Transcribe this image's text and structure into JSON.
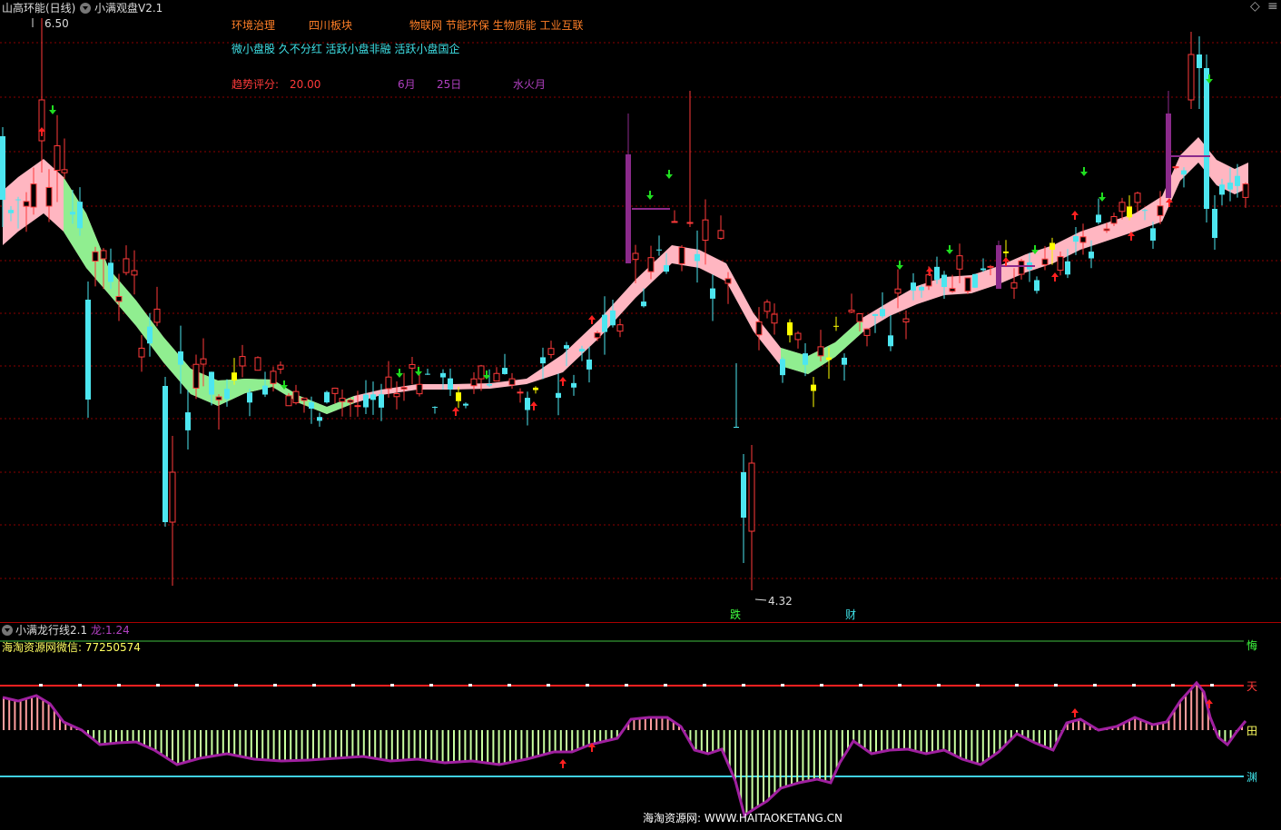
{
  "main": {
    "stock_title": "山高环能(日线)",
    "indicator_title": "小满观盘V2.1",
    "concepts_row1": [
      "环境治理",
      "四川板块",
      "物联网 节能环保 生物质能 工业互联"
    ],
    "concepts_row2": "微小盘股 久不分红 活跃小盘非融 活跃小盘国企",
    "trend_label": "趋势评分:",
    "trend_value": "20.00",
    "month": "6月",
    "day": "25日",
    "element": "水火月",
    "high_label": "6.50",
    "low_label": "4.32",
    "mark_die": "跌",
    "mark_cai": "财",
    "diamond_icon": "◇",
    "menu_icon": "≡"
  },
  "sub": {
    "title": "小满龙行线2.1",
    "dragon_label": "龙:",
    "dragon_value": "1.24",
    "watermark_top": "海淘资源网微信: 77250574",
    "label_top": "悔",
    "label_tian": "天",
    "label_tian2": "田",
    "label_yuan": "渊",
    "watermark_bottom": "海淘资源网: WWW.HAITAOKETANG.CN"
  },
  "colors": {
    "background": "#000000",
    "grid": "#8b0000",
    "bull_candle": "#ff3a3a",
    "bear_candle": "#4de6f0",
    "signal_candle": "#ffff00",
    "purple_candle": "#8b2a8b",
    "band_up": "#ffb6c1",
    "band_down": "#90ee90",
    "osc_line": "#a020a0",
    "osc_pos": "#ff9e9e",
    "osc_neg": "#c8ffa0",
    "line_tian": "#ff2020",
    "line_yuan": "#40d0e0",
    "line_top": "#40c040"
  },
  "chart_data": {
    "type": "candlestick",
    "high_price": 6.5,
    "low_price": 4.32,
    "series": [
      {
        "name": "龙",
        "last_value": 1.24
      }
    ]
  }
}
